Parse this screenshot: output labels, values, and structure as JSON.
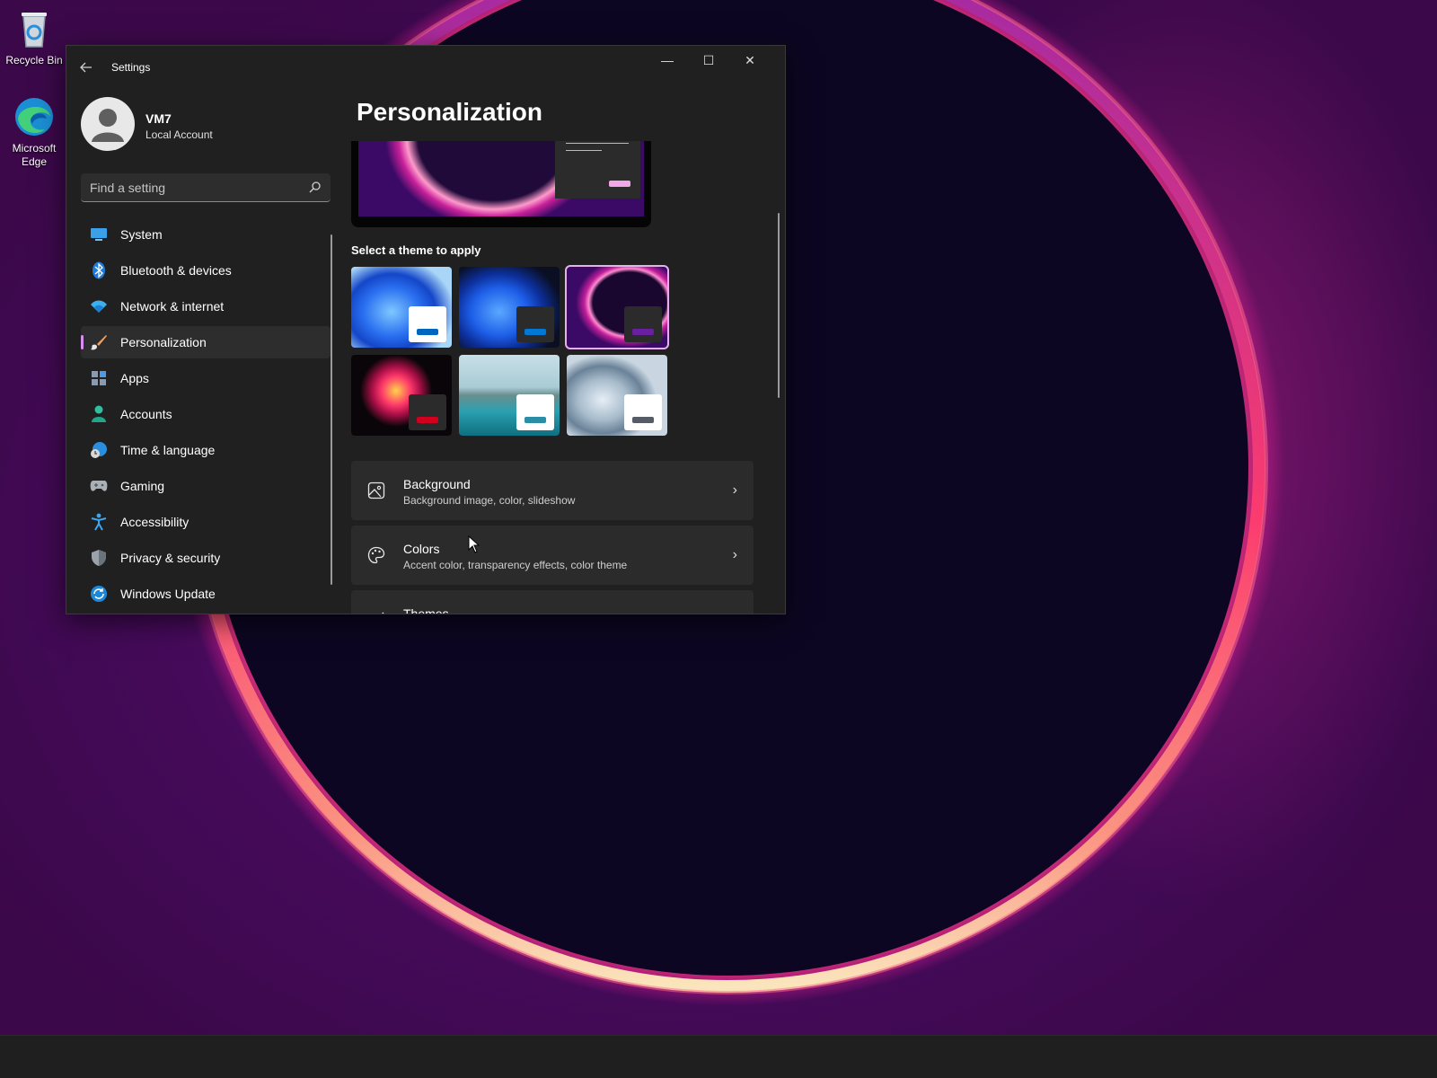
{
  "desktop": {
    "icons": [
      {
        "label": "Recycle Bin",
        "icon": "recycle-bin-icon"
      },
      {
        "label": "Microsoft Edge",
        "icon": "edge-icon"
      }
    ]
  },
  "window": {
    "title": "Settings",
    "controls": {
      "minimize": "—",
      "maximize": "☐",
      "close": "✕"
    }
  },
  "profile": {
    "name": "VM7",
    "account_type": "Local Account"
  },
  "search": {
    "placeholder": "Find a setting"
  },
  "sidebar": {
    "items": [
      {
        "label": "System",
        "icon": "system-icon"
      },
      {
        "label": "Bluetooth & devices",
        "icon": "bluetooth-icon"
      },
      {
        "label": "Network & internet",
        "icon": "wifi-icon"
      },
      {
        "label": "Personalization",
        "icon": "brush-icon",
        "active": true
      },
      {
        "label": "Apps",
        "icon": "apps-icon"
      },
      {
        "label": "Accounts",
        "icon": "accounts-icon"
      },
      {
        "label": "Time & language",
        "icon": "globe-clock-icon"
      },
      {
        "label": "Gaming",
        "icon": "gamepad-icon"
      },
      {
        "label": "Accessibility",
        "icon": "accessibility-icon"
      },
      {
        "label": "Privacy & security",
        "icon": "shield-icon"
      },
      {
        "label": "Windows Update",
        "icon": "update-icon"
      }
    ]
  },
  "main": {
    "title": "Personalization",
    "theme_section_label": "Select a theme to apply",
    "themes": [
      {
        "name": "windows-light",
        "accent": "#0067c0"
      },
      {
        "name": "windows-dark",
        "accent": "#0078d4"
      },
      {
        "name": "glow",
        "accent": "#6a1ea0",
        "selected": true
      },
      {
        "name": "captured-motion",
        "accent": "#d1001f"
      },
      {
        "name": "sunrise",
        "accent": "#2a8fa6"
      },
      {
        "name": "flow",
        "accent": "#555c66"
      }
    ],
    "cards": [
      {
        "title": "Background",
        "subtitle": "Background image, color, slideshow",
        "icon": "image-icon"
      },
      {
        "title": "Colors",
        "subtitle": "Accent color, transparency effects, color theme",
        "icon": "palette-icon"
      },
      {
        "title": "Themes",
        "subtitle": "",
        "icon": "brush-icon"
      }
    ]
  },
  "colors": {
    "window_bg": "#202020",
    "card_bg": "#2b2b2b",
    "accent": "#d78ef0"
  }
}
